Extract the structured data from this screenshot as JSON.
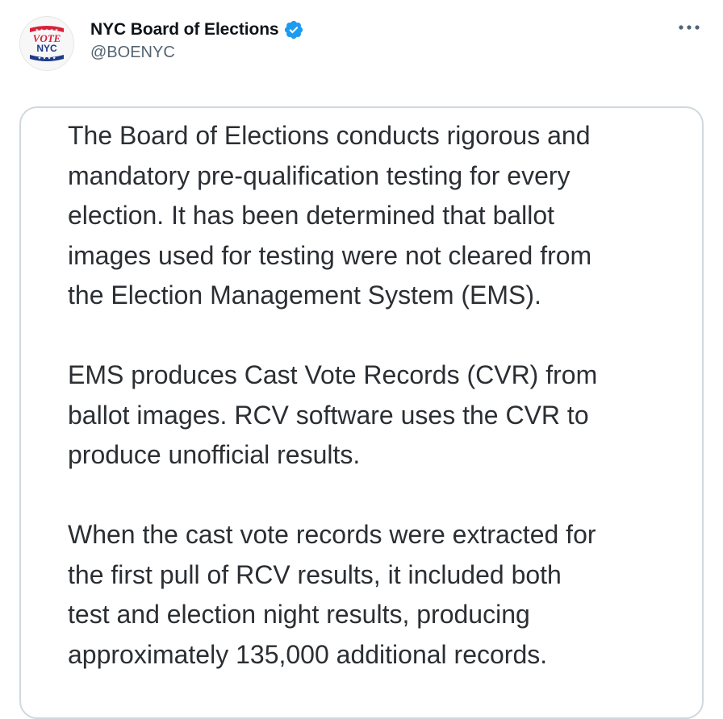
{
  "tweet": {
    "author": {
      "display_name": "NYC Board of Elections",
      "handle": "@BOENYC",
      "verified": true,
      "avatar_text_top": "VOTE",
      "avatar_text_bottom": "NYC"
    },
    "more_icon": "more-horizontal-icon",
    "quote": {
      "paragraphs": [
        {
          "lines": [
            "The Board of Elections conducts rigorous and",
            "mandatory pre-qualification testing for every",
            "election. It has been determined that ballot",
            "images used for testing were not cleared from",
            "the Election Management System (EMS)."
          ]
        },
        {
          "lines": [
            "EMS produces Cast Vote Records (CVR) from",
            "ballot images. RCV software uses the CVR to",
            "produce unofficial results."
          ]
        },
        {
          "lines": [
            "When the cast vote records were extracted for",
            "the first pull of RCV results, it included both",
            "test and election night results, producing",
            "approximately 135,000 additional records."
          ]
        }
      ]
    }
  },
  "colors": {
    "verified_blue": "#1d9bf0",
    "text_primary": "#0f1419",
    "text_secondary": "#536471",
    "card_border": "#cfd9de",
    "avatar_red": "#d6203a",
    "avatar_navy": "#1e3a8a"
  }
}
